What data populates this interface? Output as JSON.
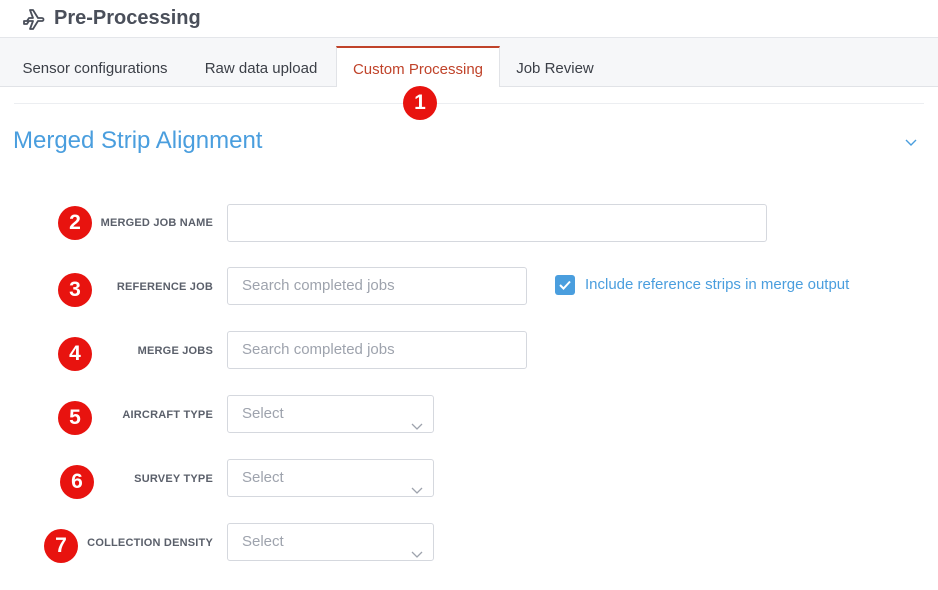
{
  "header": {
    "title": "Pre-Processing",
    "icon": "plane-icon"
  },
  "tabs": [
    {
      "label": "Sensor configurations",
      "active": false
    },
    {
      "label": "Raw data upload",
      "active": false
    },
    {
      "label": "Custom Processing",
      "active": true
    },
    {
      "label": "Job Review",
      "active": false
    }
  ],
  "section": {
    "title": "Merged Strip Alignment",
    "collapse_icon": "chevron-down-icon"
  },
  "markers": [
    "1",
    "2",
    "3",
    "4",
    "5",
    "6",
    "7"
  ],
  "form": {
    "merged_job_name": {
      "label": "MERGED JOB NAME",
      "value": ""
    },
    "reference_job": {
      "label": "REFERENCE JOB",
      "placeholder": "Search completed jobs"
    },
    "include_reference": {
      "label": "Include reference strips in merge output",
      "checked": true
    },
    "merge_jobs": {
      "label": "MERGE JOBS",
      "placeholder": "Search completed jobs"
    },
    "aircraft_type": {
      "label": "AIRCRAFT TYPE",
      "value": "Select"
    },
    "survey_type": {
      "label": "SURVEY TYPE",
      "value": "Select"
    },
    "collection_density": {
      "label": "COLLECTION DENSITY",
      "value": "Select"
    }
  },
  "colors": {
    "accent": "#4a9ede",
    "active_tab": "#c0432a",
    "marker": "#e8130f"
  }
}
